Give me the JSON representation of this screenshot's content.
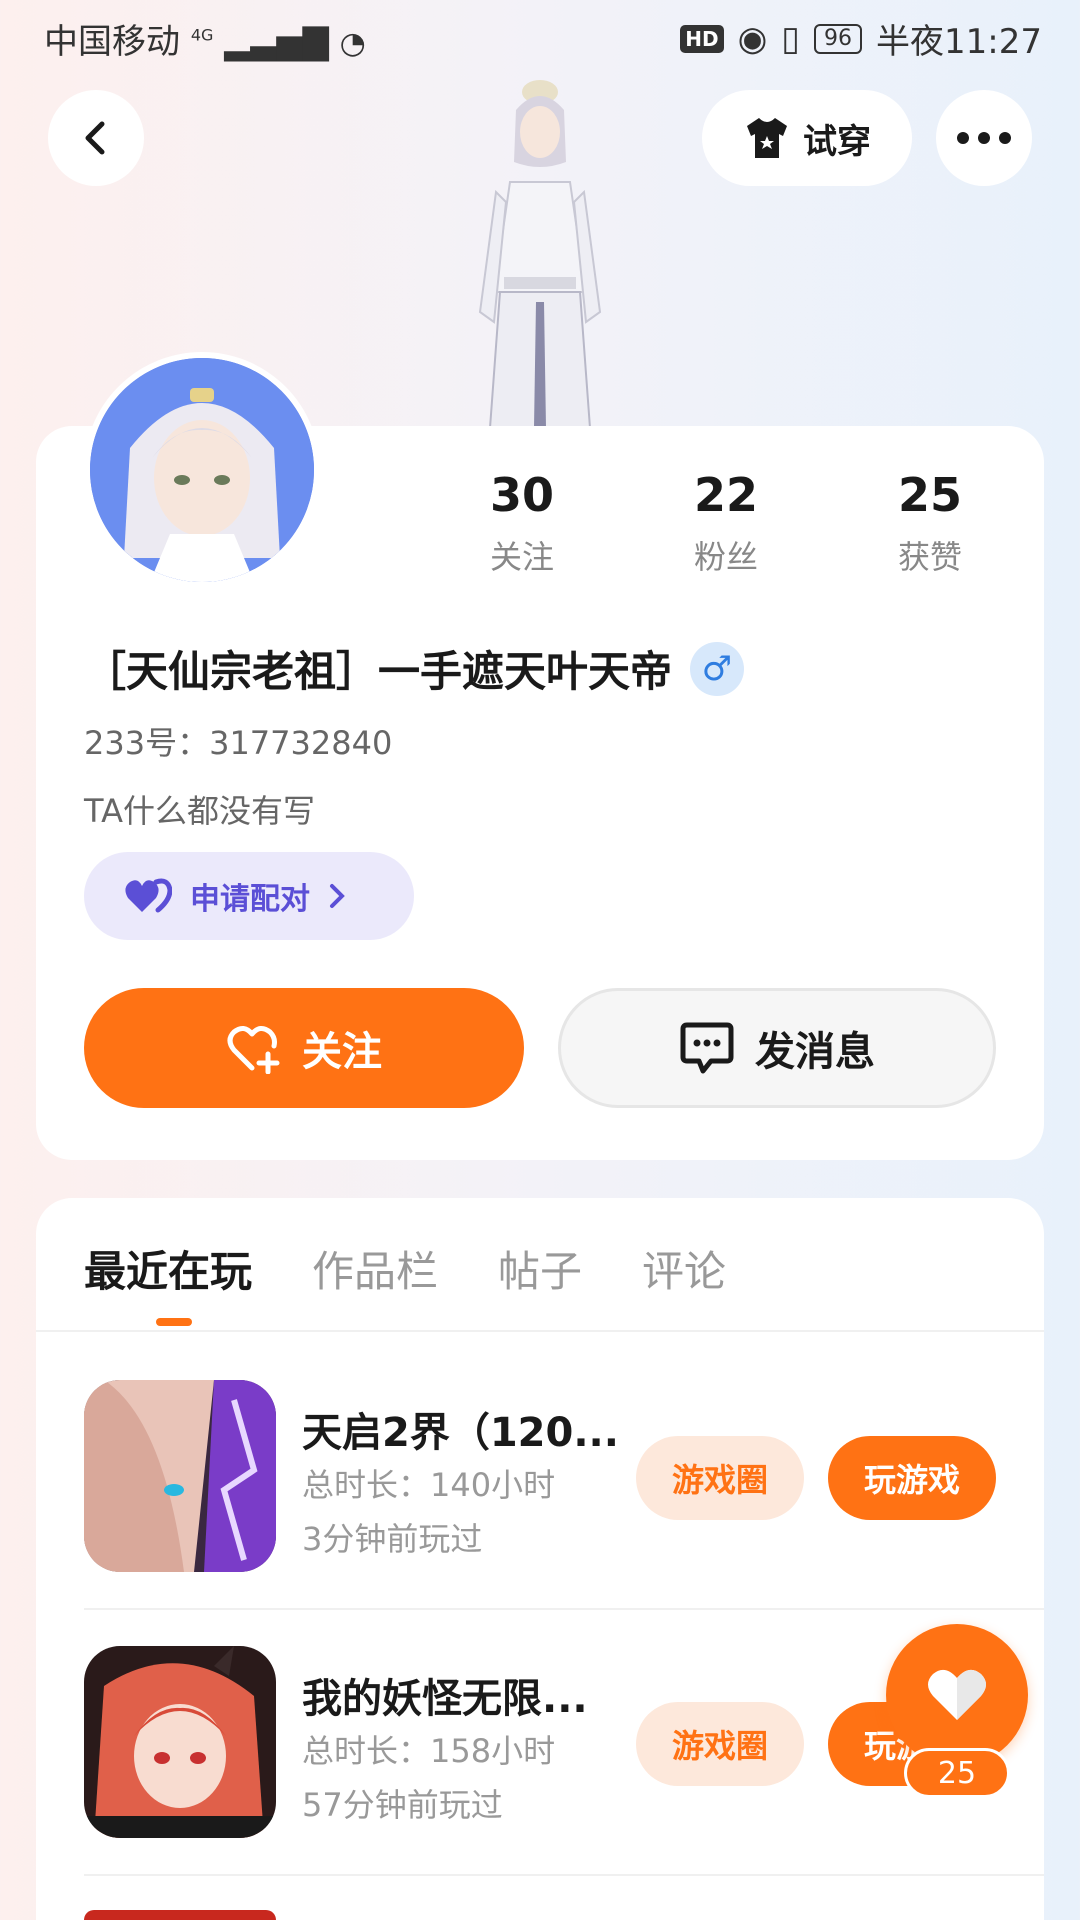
{
  "status_bar": {
    "carrier": "中国移动",
    "network": "4G",
    "hd_badge": "HD",
    "battery": "96",
    "time": "半夜11:27"
  },
  "top_nav": {
    "tryon_label": "试穿"
  },
  "profile": {
    "stats": [
      {
        "value": "30",
        "label": "关注"
      },
      {
        "value": "22",
        "label": "粉丝"
      },
      {
        "value": "25",
        "label": "获赞"
      }
    ],
    "nickname": "［天仙宗老祖］一手遮天叶天帝",
    "gender_symbol": "♂",
    "uid": "233号：317732840",
    "bio": "TA什么都没有写",
    "pair_label": "申请配对",
    "follow_label": "关注",
    "message_label": "发消息"
  },
  "tabs": [
    {
      "label": "最近在玩",
      "active": true
    },
    {
      "label": "作品栏",
      "active": false
    },
    {
      "label": "帖子",
      "active": false
    },
    {
      "label": "评论",
      "active": false
    }
  ],
  "games": [
    {
      "name": "天启2界（120...",
      "duration": "总时长：140小时",
      "last_played": "3分钟前玩过",
      "circle_label": "游戏圈",
      "play_label": "玩游戏"
    },
    {
      "name": "我的妖怪无限...",
      "duration": "总时长：158小时",
      "last_played": "57分钟前玩过",
      "circle_label": "游戏圈",
      "play_label": "玩游戏"
    }
  ],
  "floating_like": {
    "count": "25"
  },
  "colors": {
    "accent": "#ff7214",
    "pair_accent": "#5b4fd6",
    "gender_blue": "#2f7de0"
  },
  "icons": {
    "back": "chevron-left-icon",
    "tryon": "tshirt-icon",
    "more": "more-dots-icon",
    "pair": "heart-pair-icon",
    "follow": "heart-plus-icon",
    "message": "chat-bubble-icon",
    "like": "heart-icon"
  }
}
